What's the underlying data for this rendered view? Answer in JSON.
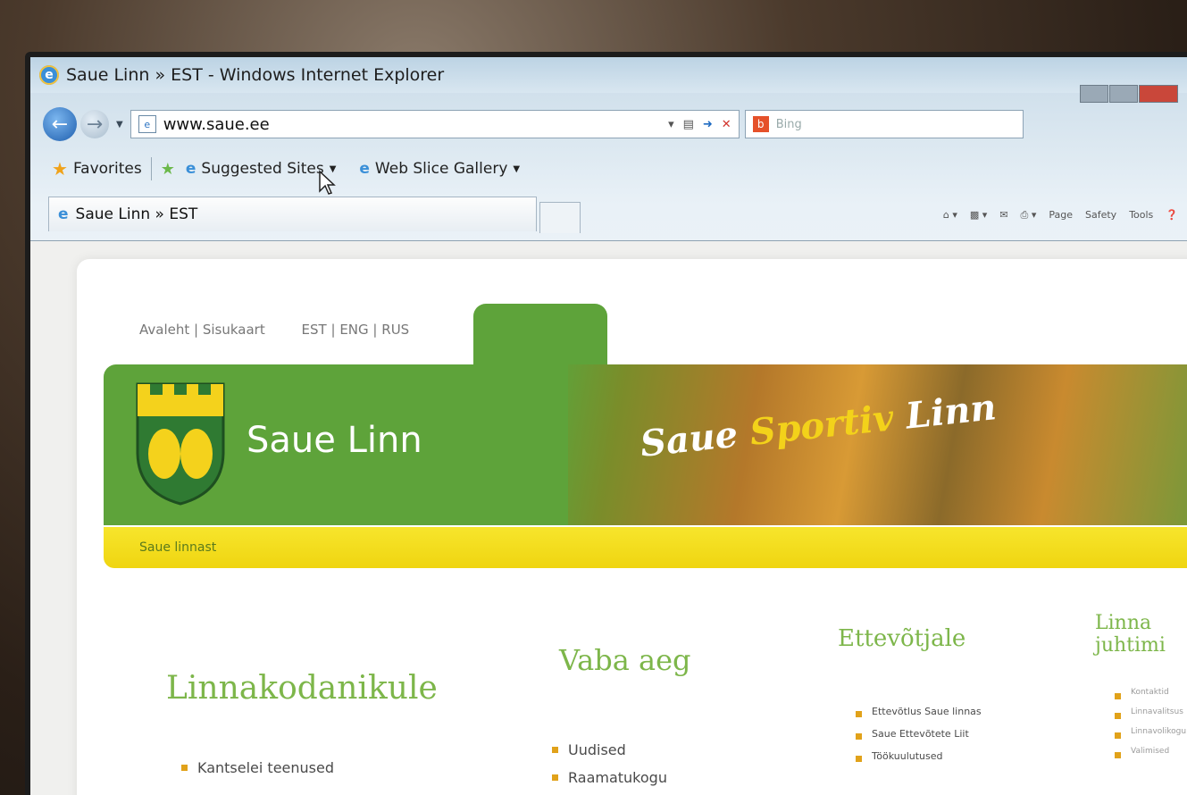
{
  "window": {
    "title": "Saue Linn » EST - Windows Internet Explorer"
  },
  "address_bar": {
    "url": "www.saue.ee",
    "search_placeholder": "Bing"
  },
  "favorites_bar": {
    "favorites_label": "Favorites",
    "suggested_sites": "Suggested Sites",
    "web_slice_gallery": "Web Slice Gallery"
  },
  "tabs": [
    {
      "label": "Saue Linn » EST"
    }
  ],
  "command_bar": {
    "page": "Page",
    "safety": "Safety",
    "tools": "Tools"
  },
  "site": {
    "nav_links": [
      "Avaleht",
      "Sisukaart"
    ],
    "languages": [
      "EST",
      "ENG",
      "RUS"
    ],
    "name": "Saue Linn",
    "slogan_a": "Saue ",
    "slogan_b": "Sportiv",
    "slogan_c": " Linn",
    "subnav": "Saue linnast"
  },
  "columns": [
    {
      "title": "Linnakodanikule",
      "items": [
        "Kantselei teenused"
      ]
    },
    {
      "title": "Vaba aeg",
      "items": [
        "Uudised",
        "Raamatukogu"
      ]
    },
    {
      "title": "Ettevõtjale",
      "items": [
        "Ettevõtlus Saue linnas",
        "Saue Ettevõtete Liit",
        "Töökuulutused"
      ]
    },
    {
      "title": "Linna juhtimi",
      "items": [
        "Kontaktid",
        "Linnavalitsus",
        "Linnavolikogu",
        "Valimised"
      ]
    }
  ]
}
